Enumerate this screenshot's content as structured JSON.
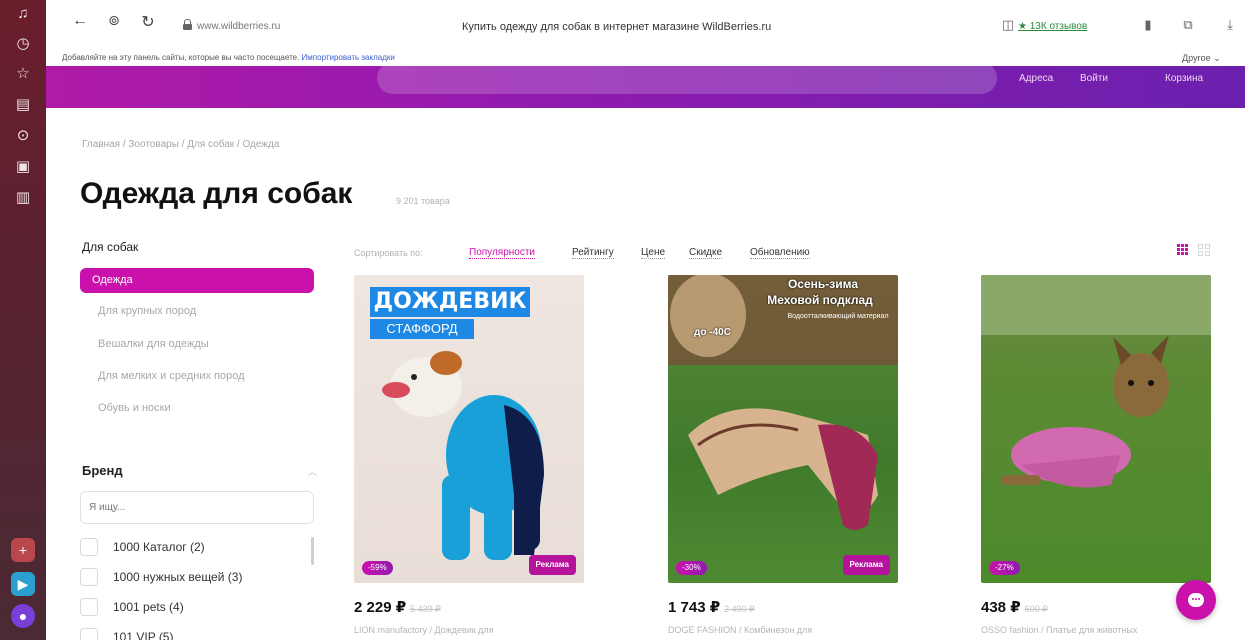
{
  "browser": {
    "url": "www.wildberries.ru",
    "page_title": "Купить одежду для собак в интернет магазине WildBerries.ru",
    "reviews": "★ 13К отзывов",
    "bookmarks_hint": "Добавляйте на эту панель сайты, которые вы часто посещаете.",
    "bookmarks_import": "Импортировать закладки",
    "other_bookmarks": "Другое ⌄"
  },
  "site_header": {
    "links": [
      "Адреса",
      "Войти",
      "Корзина"
    ]
  },
  "breadcrumb": "Главная / Зоотовары / Для собак / Одежда",
  "page": {
    "title": "Одежда для собак",
    "count": "9 201 товара"
  },
  "categories": {
    "title": "Для собак",
    "active": "Одежда",
    "items": [
      "Для крупных пород",
      "Вешалки для одежды",
      "Для мелких и средних пород",
      "Обувь и носки"
    ]
  },
  "brand_filter": {
    "title": "Бренд",
    "placeholder": "Я ищу...",
    "items": [
      "1000 Каталог (2)",
      "1000 нужных вещей (3)",
      "1001 pets (4)",
      "101 VIP (5)"
    ]
  },
  "sort": {
    "label": "Сортировать по:",
    "options": [
      "Популярности",
      "Рейтингу",
      "Цене",
      "Скидке",
      "Обновлению"
    ]
  },
  "products": [
    {
      "img_text_top": "ДОЖДЕВИК",
      "img_text_sub": "СТАФФОРД",
      "discount": "-59%",
      "ad": "Реклама",
      "price": "2 229 ₽",
      "old_price": "5 439 ₽",
      "desc": "LION manufactory / Дождевик для"
    },
    {
      "img_text_top": "Осень-зима",
      "img_text_sub": "Меховой подклад",
      "img_text_3": "Водоотталкивающий материал",
      "img_badge": "до -40С",
      "discount": "-30%",
      "ad": "Реклама",
      "price": "1 743 ₽",
      "old_price": "2 490 ₽",
      "desc": "DOGE FASHION / Комбинезон для"
    },
    {
      "discount": "-27%",
      "price": "438 ₽",
      "old_price": "600 ₽",
      "desc": "OSSO fashion / Платье для животных"
    }
  ],
  "colors": {
    "brand": "#cb11ab",
    "header_start": "#b01aa8",
    "header_end": "#6a20ad"
  },
  "icons": {
    "sidebar": [
      "bell-icon",
      "clock-icon",
      "star-icon",
      "collections-icon",
      "play-icon",
      "calendar-icon",
      "downloads-icon",
      "add-icon",
      "app-icon",
      "app-icon-2"
    ],
    "toolbar": [
      "back-icon",
      "home-icon",
      "reload-icon",
      "lock-icon",
      "reader-icon",
      "bookmark-icon",
      "extensions-icon",
      "download-icon"
    ]
  }
}
